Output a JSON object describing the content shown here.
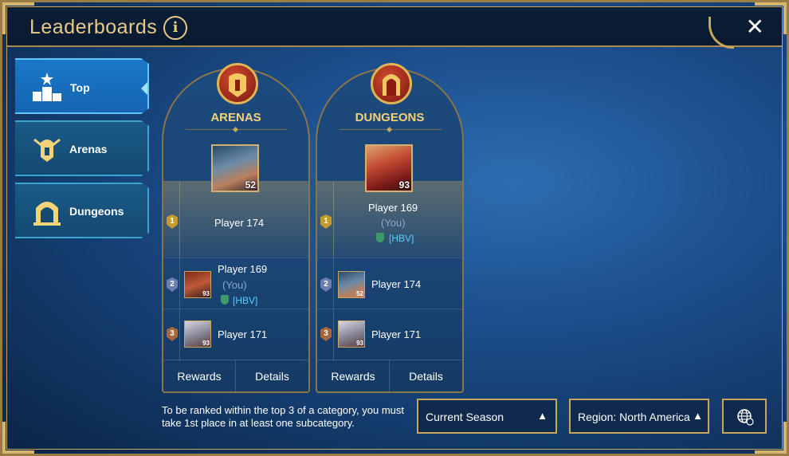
{
  "header": {
    "title": "Leaderboards",
    "info_glyph": "i",
    "close_glyph": "✕"
  },
  "sidebar": {
    "items": [
      {
        "label": "Top",
        "icon": "podium-icon",
        "active": true
      },
      {
        "label": "Arenas",
        "icon": "arena-helmet-icon",
        "active": false
      },
      {
        "label": "Dungeons",
        "icon": "dungeon-gate-icon",
        "active": false
      }
    ]
  },
  "cards": [
    {
      "title": "ARENAS",
      "emblem": "arena-helmet-icon",
      "first": {
        "rank": "1",
        "name": "Player 174",
        "level": "52"
      },
      "second": {
        "rank": "2",
        "name": "Player 169",
        "you": "(You)",
        "clan": "[HBV]",
        "level": "93"
      },
      "third": {
        "rank": "3",
        "name": "Player 171",
        "level": "93"
      },
      "rewards_label": "Rewards",
      "details_label": "Details"
    },
    {
      "title": "DUNGEONS",
      "emblem": "dungeon-gate-icon",
      "first": {
        "rank": "1",
        "name": "Player 169",
        "you": "(You)",
        "clan": "[HBV]",
        "level": "93"
      },
      "second": {
        "rank": "2",
        "name": "Player 174",
        "level": "52"
      },
      "third": {
        "rank": "3",
        "name": "Player 171",
        "level": "93"
      },
      "rewards_label": "Rewards",
      "details_label": "Details"
    }
  ],
  "footer": {
    "note": "To be ranked within the top 3 of a category, you must take 1st place in at least one subcategory.",
    "season_label": "Current Season",
    "region_label": "Region: North America",
    "chevron": "▲"
  },
  "colors": {
    "accent_gold": "#e7c98a",
    "clan_cyan": "#55d0ff",
    "active_tab": "#1a78c8"
  }
}
